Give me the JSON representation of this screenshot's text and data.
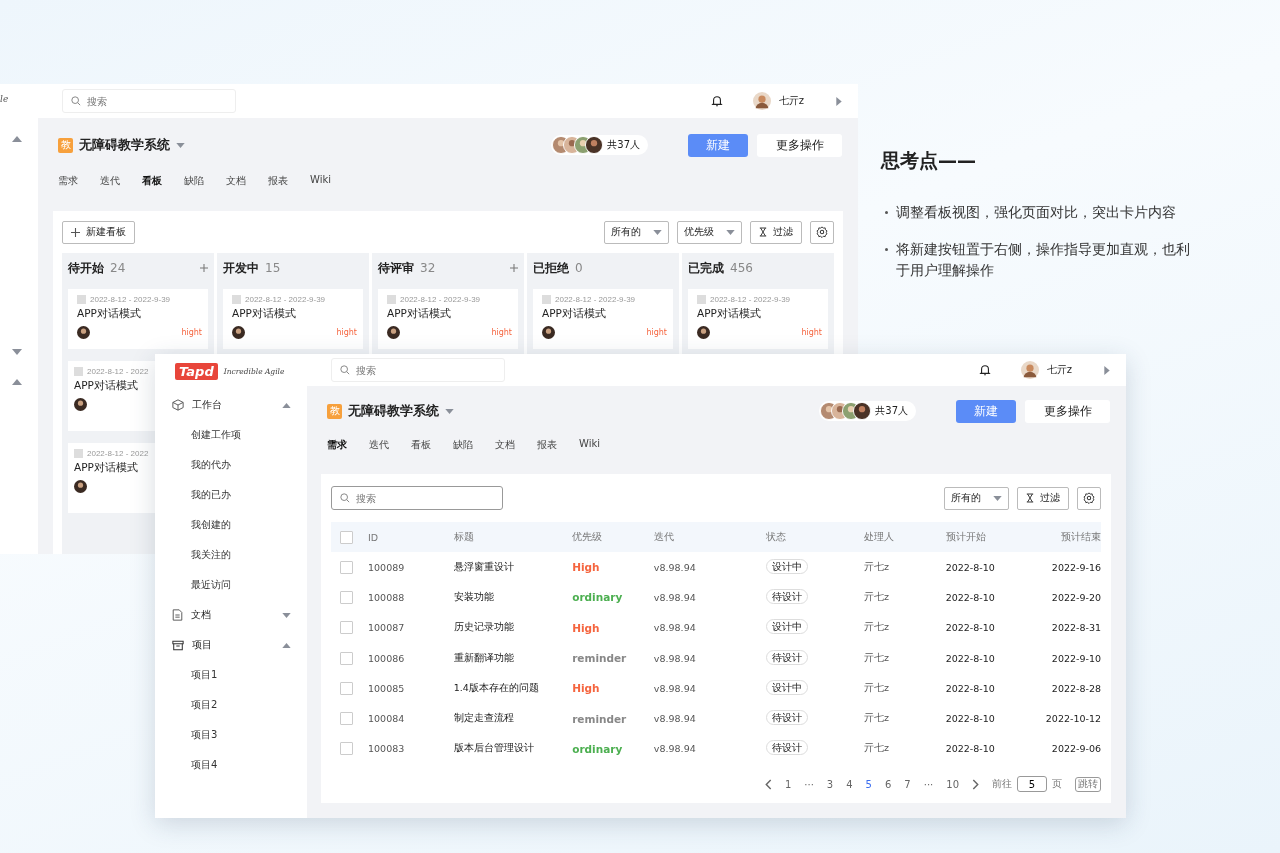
{
  "board_window": {
    "brand_fragment": "le",
    "sidebar_groups": [
      {
        "expanded": true
      },
      {
        "expanded": false
      },
      {
        "expanded": true
      }
    ],
    "search": {
      "placeholder": "搜索"
    },
    "user": {
      "name": "七亓z"
    },
    "project": {
      "badge": "教",
      "name": "无障碍教学系统"
    },
    "member_count": "共37人",
    "buttons": {
      "new": "新建",
      "more": "更多操作"
    },
    "tabs": [
      {
        "label": "需求",
        "selected": false
      },
      {
        "label": "迭代",
        "selected": false
      },
      {
        "label": "看板",
        "selected": true
      },
      {
        "label": "缺陷",
        "selected": false
      },
      {
        "label": "文档",
        "selected": false
      },
      {
        "label": "报表",
        "selected": false
      },
      {
        "label": "Wiki",
        "selected": false
      }
    ],
    "toolbar": {
      "new_board": "新建看板",
      "dropdowns": [
        "所有的",
        "优先级"
      ],
      "filter": "过滤"
    },
    "columns": [
      {
        "title": "待开始",
        "count": "24",
        "addable": true,
        "cards": [
          {
            "date": "2022-8-12 - 2022-9-39",
            "title": "APP对话模式",
            "priority": "hight"
          },
          {
            "date": "2022-8-12 - 2022",
            "title": "APP对话模式"
          },
          {
            "date": "2022-8-12 - 2022",
            "title": "APP对话模式"
          }
        ]
      },
      {
        "title": "开发中",
        "count": "15",
        "addable": false,
        "cards": [
          {
            "date": "2022-8-12 - 2022-9-39",
            "title": "APP对话模式",
            "priority": "hight"
          }
        ]
      },
      {
        "title": "待评审",
        "count": "32",
        "addable": true,
        "cards": [
          {
            "date": "2022-8-12 - 2022-9-39",
            "title": "APP对话模式",
            "priority": "hight"
          }
        ]
      },
      {
        "title": "已拒绝",
        "count": "0",
        "addable": false,
        "cards": [
          {
            "date": "2022-8-12 - 2022-9-39",
            "title": "APP对话模式",
            "priority": "hight"
          }
        ]
      },
      {
        "title": "已完成",
        "count": "456",
        "addable": false,
        "cards": [
          {
            "date": "2022-8-12 - 2022-9-39",
            "title": "APP对话模式",
            "priority": "hight"
          }
        ]
      }
    ]
  },
  "list_window": {
    "logo": "Tapd",
    "tagline": "Incredible Agile",
    "sidebar": [
      {
        "label": "工作台",
        "expanded": true,
        "children": [
          {
            "label": "创建工作项"
          },
          {
            "label": "我的代办"
          },
          {
            "label": "我的已办"
          },
          {
            "label": "我创建的"
          },
          {
            "label": "我关注的"
          },
          {
            "label": "最近访问"
          }
        ]
      },
      {
        "label": "文档",
        "expanded": false
      },
      {
        "label": "项目",
        "expanded": true,
        "children": [
          {
            "label": "项目1"
          },
          {
            "label": "项目2"
          },
          {
            "label": "项目3"
          },
          {
            "label": "项目4"
          }
        ]
      }
    ],
    "search": {
      "placeholder": "搜索"
    },
    "user": {
      "name": "七亓z"
    },
    "project": {
      "badge": "教",
      "name": "无障碍教学系统"
    },
    "member_count": "共37人",
    "buttons": {
      "new": "新建",
      "more": "更多操作"
    },
    "tabs": [
      {
        "label": "需求",
        "selected": true
      },
      {
        "label": "迭代",
        "selected": false
      },
      {
        "label": "看板",
        "selected": false
      },
      {
        "label": "缺陷",
        "selected": false
      },
      {
        "label": "文档",
        "selected": false
      },
      {
        "label": "报表",
        "selected": false
      },
      {
        "label": "Wiki",
        "selected": false
      }
    ],
    "toolbar": {
      "search_placeholder": "搜索",
      "dropdown": "所有的",
      "filter": "过滤"
    },
    "table": {
      "header_checked": false,
      "columns": [
        "ID",
        "标题",
        "优先级",
        "迭代",
        "状态",
        "处理人",
        "预计开始",
        "预计结束"
      ],
      "rows": [
        {
          "checked": false,
          "id": "100089",
          "title": "悬浮窗重设计",
          "priority": "High",
          "color": "#f5653f",
          "iteration": "v8.98.94",
          "status": "设计中",
          "owner": "亓七z",
          "start": "2022-8-10",
          "end": "2022-9-16"
        },
        {
          "checked": false,
          "id": "100088",
          "title": "安装功能",
          "priority": "ordinary",
          "color": "#4caf50",
          "iteration": "v8.98.94",
          "status": "待设计",
          "owner": "亓七z",
          "start": "2022-8-10",
          "end": "2022-9-20"
        },
        {
          "checked": false,
          "id": "100087",
          "title": "历史记录功能",
          "priority": "High",
          "color": "#f5653f",
          "iteration": "v8.98.94",
          "status": "设计中",
          "owner": "亓七z",
          "start": "2022-8-10",
          "end": "2022-8-31"
        },
        {
          "checked": false,
          "id": "100086",
          "title": "重新翻译功能",
          "priority": "reminder",
          "color": "#888888",
          "iteration": "v8.98.94",
          "status": "待设计",
          "owner": "亓七z",
          "start": "2022-8-10",
          "end": "2022-9-10"
        },
        {
          "checked": false,
          "id": "100085",
          "title": "1.4版本存在的问题",
          "priority": "High",
          "color": "#f5653f",
          "iteration": "v8.98.94",
          "status": "设计中",
          "owner": "亓七z",
          "start": "2022-8-10",
          "end": "2022-8-28"
        },
        {
          "checked": false,
          "id": "100084",
          "title": "制定走查流程",
          "priority": "reminder",
          "color": "#888888",
          "iteration": "v8.98.94",
          "status": "待设计",
          "owner": "亓七z",
          "start": "2022-8-10",
          "end": "2022-10-12"
        },
        {
          "checked": false,
          "id": "100083",
          "title": "版本后台管理设计",
          "priority": "ordinary",
          "color": "#4caf50",
          "iteration": "v8.98.94",
          "status": "待设计",
          "owner": "亓七z",
          "start": "2022-8-10",
          "end": "2022-9-06"
        }
      ]
    },
    "pagination": {
      "pages": [
        {
          "label": "1",
          "selected": false
        },
        {
          "label": "···",
          "selected": false
        },
        {
          "label": "3",
          "selected": false
        },
        {
          "label": "4",
          "selected": false
        },
        {
          "label": "5",
          "selected": true
        },
        {
          "label": "6",
          "selected": false
        },
        {
          "label": "7",
          "selected": false
        },
        {
          "label": "···",
          "selected": false
        },
        {
          "label": "10",
          "selected": false
        }
      ],
      "goto_label": "前往",
      "page_input": "5",
      "page_unit": "页",
      "jump": "跳转"
    }
  },
  "notes": {
    "title": "思考点——",
    "points": [
      "调整看板视图，强化页面对比，突出卡片内容",
      "将新建按钮置于右侧，操作指导更加直观，也利于用户理解操作"
    ]
  }
}
